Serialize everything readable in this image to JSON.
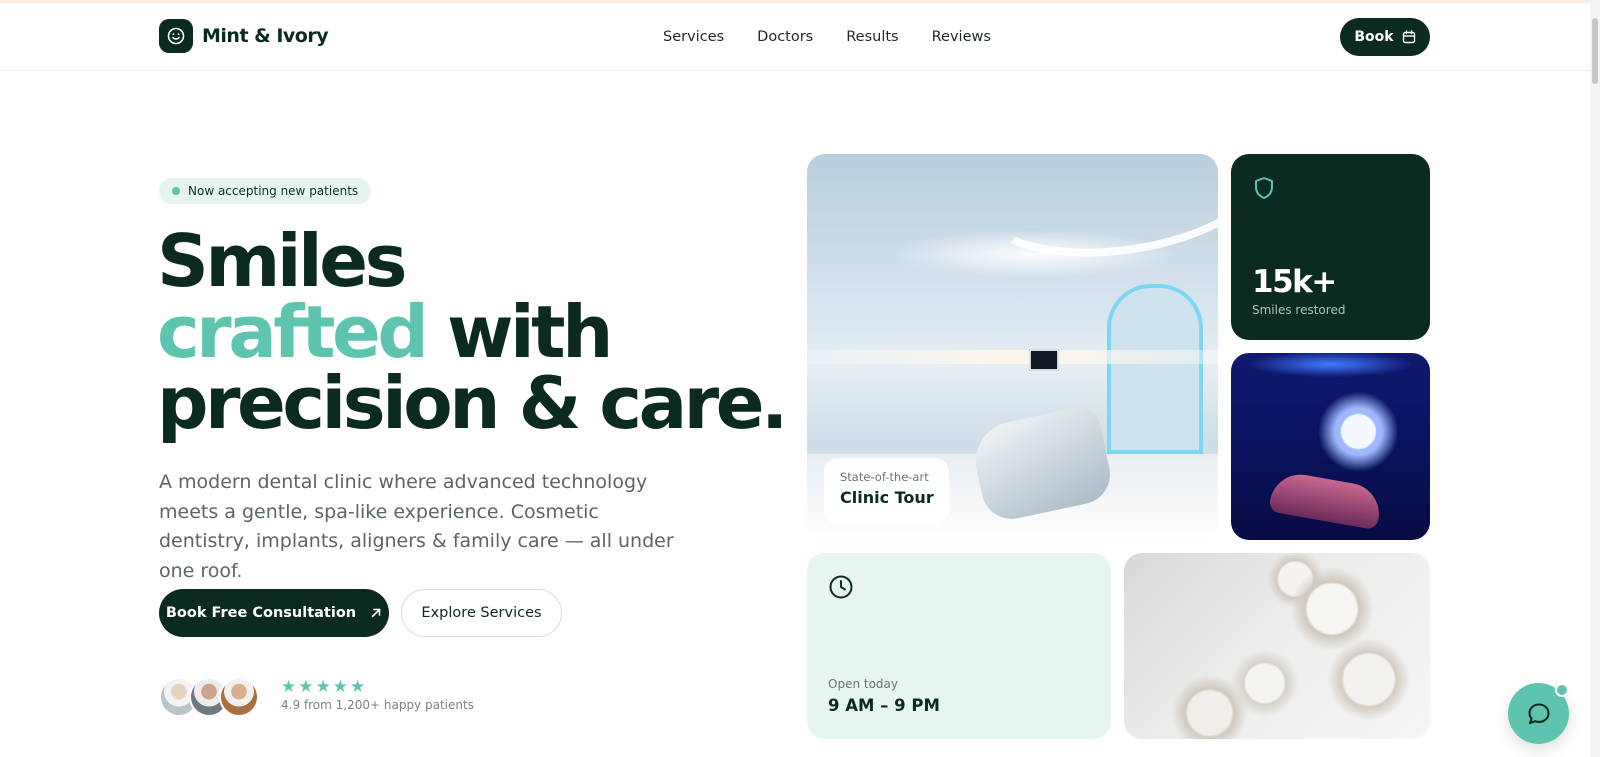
{
  "brand": {
    "name": "Mint & Ivory",
    "logo_icon": "smile-icon"
  },
  "nav": {
    "items": [
      "Services",
      "Doctors",
      "Results",
      "Reviews"
    ]
  },
  "header": {
    "book_label": "Book",
    "book_icon": "calendar-icon"
  },
  "hero": {
    "badge": "Now accepting new patients",
    "headline_line1": "Smiles",
    "headline_accent": "crafted",
    "headline_line2_rest": " with",
    "headline_line3": "precision & care.",
    "lead": "A modern dental clinic where advanced technology meets a gentle, spa-like experience. Cosmetic dentistry, implants, aligners & family care — all under one roof.",
    "cta_primary": "Book Free Consultation",
    "cta_secondary": "Explore Services",
    "rating_stars": "★★★★★",
    "rating_text": "4.9 from 1,200+ happy patients"
  },
  "tour": {
    "kicker": "State-of-the-art",
    "title": "Clinic Tour"
  },
  "stat": {
    "value": "15k+",
    "label": "Smiles restored",
    "icon": "shield-icon"
  },
  "hours": {
    "kicker": "Open today",
    "value": "9 AM – 9 PM",
    "icon": "clock-icon"
  },
  "colors": {
    "primary": "#0b2a22",
    "accent": "#5ec4b0",
    "mint_bg": "#e6f5f0"
  }
}
